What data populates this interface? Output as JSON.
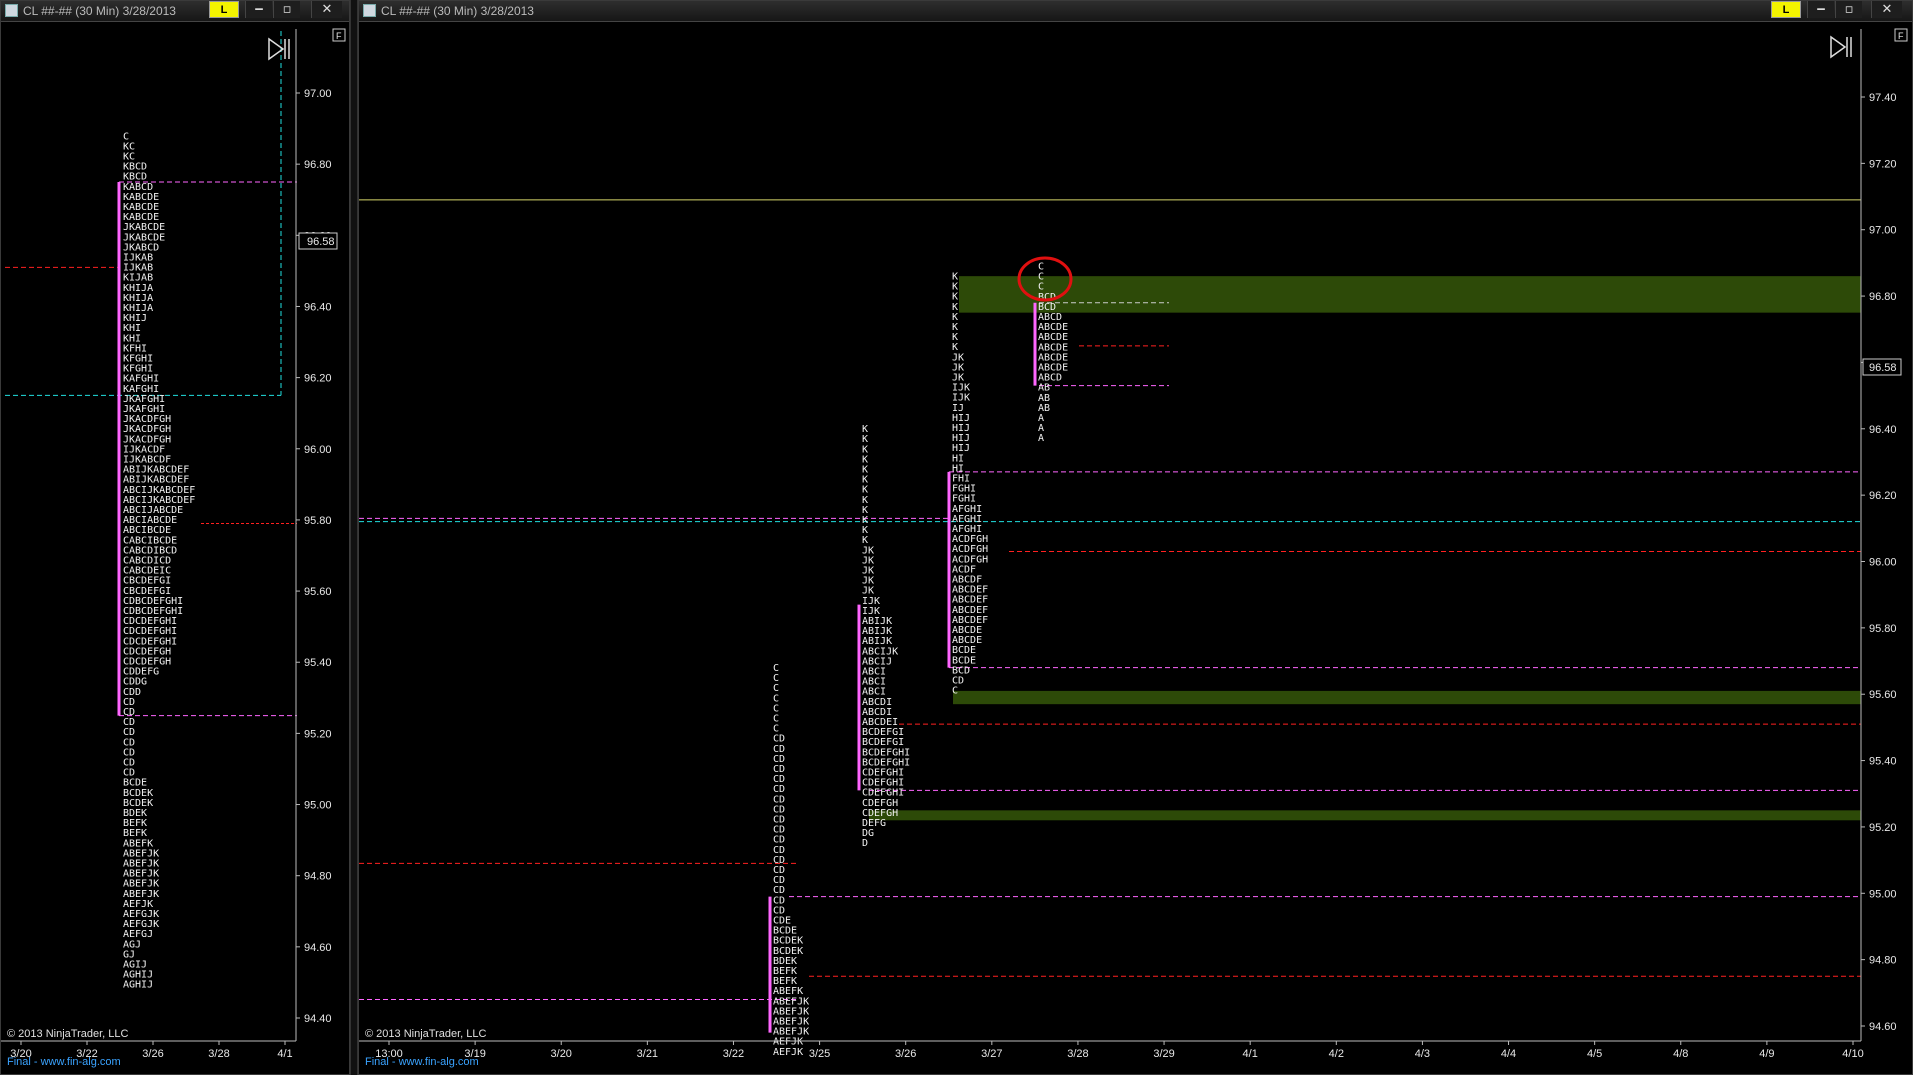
{
  "left_window": {
    "title": "CL ##-## (30 Min)  3/28/2013",
    "l_label": "L",
    "min_icon": "minimize-icon",
    "max_icon": "maximize-icon",
    "close_icon": "close-icon",
    "f_label": "F",
    "copyright": "© 2013 NinjaTrader, LLC",
    "final_label": "Final - www.fin-alg.com",
    "price_badge": "96.58",
    "y_ticks": [
      "97.00",
      "96.80",
      "96.60",
      "96.40",
      "96.20",
      "96.00",
      "95.80",
      "95.60",
      "95.40",
      "95.20",
      "95.00",
      "94.80",
      "94.60",
      "94.40"
    ],
    "x_ticks": [
      "3/20",
      "3/22",
      "3/26",
      "3/28",
      "4/1"
    ]
  },
  "right_window": {
    "title": "CL ##-## (30 Min)  3/28/2013",
    "l_label": "L",
    "min_icon": "minimize-icon",
    "max_icon": "maximize-icon",
    "close_icon": "close-icon",
    "f_label": "F",
    "copyright": "© 2013 NinjaTrader, LLC",
    "final_label": "Final - www.fin-alg.com",
    "price_badge": "96.58",
    "y_ticks": [
      "97.40",
      "97.20",
      "97.00",
      "96.80",
      "96.60",
      "96.40",
      "96.20",
      "96.00",
      "95.80",
      "95.60",
      "95.40",
      "95.20",
      "95.00",
      "94.80",
      "94.60"
    ],
    "x_ticks": [
      "13:00",
      "3/19",
      "3/20",
      "3/21",
      "3/22",
      "3/25",
      "3/26",
      "3/27",
      "3/28",
      "3/29",
      "4/1",
      "4/2",
      "4/3",
      "4/4",
      "4/5",
      "4/8",
      "4/9",
      "4/10"
    ]
  },
  "chart_data": [
    {
      "type": "market-profile",
      "panel": "left",
      "yscale": {
        "min": 94.4,
        "max": 97.0
      },
      "current_price": 96.58,
      "profile": {
        "top_price": 96.87,
        "rows": [
          "C",
          "KC",
          "KC",
          "KBCD",
          "KBCD",
          "KABCD",
          "KABCDE",
          "KABCDE",
          "KABCDE",
          "JKABCDE",
          "JKABCDE",
          "JKABCD",
          "IJKAB",
          "IJKAB",
          "KIJAB",
          "KHIJA",
          "KHIJA",
          "KHIJA",
          "KHIJ",
          "KHI",
          "KHI",
          "KFHI",
          "KFGHI",
          "KFGHI",
          "KAFGHI",
          "KAFGHI",
          "JKAFGHI",
          "JKAFGHI",
          "JKACDFGH",
          "JKACDFGH",
          "JKACDFGH",
          "IJKACDF",
          "IJKABCDF",
          "ABIJKABCDEF",
          "ABIJKABCDEF",
          "ABCIJKABCDEF",
          "ABCIJKABCDEF",
          "ABCIJABCDE",
          "ABCIABCDE",
          "ABCIBCDE",
          "CABCIBCDE",
          "CABCDIBCD",
          "CABCDICD",
          "CABCDEIC",
          "CBCDEFGI",
          "CBCDEFGI",
          "CDBCDEFGHI",
          "CDBCDEFGHI",
          "CDCDEFGHI",
          "CDCDEFGHI",
          "CDCDEFGHI",
          "CDCDEFGH",
          "CDCDEFGH",
          "CDDEFG",
          "CDDG",
          "CDD",
          "CD",
          "CD",
          "CD",
          "CD",
          "CD",
          "CD",
          "CD",
          "CD",
          "BCDE",
          "BCDEK",
          "BCDEK",
          "BDEK",
          "BEFK",
          "BEFK",
          "ABEFK",
          "ABEFJK",
          "ABEFJK",
          "ABEFJK",
          "ABEFJK",
          "ABEFJK",
          "AEFJK",
          "AEFGJK",
          "AEFGJK",
          "AEFGJ",
          "AGJ",
          "GJ",
          "AGIJ",
          "AGHIJ",
          "AGHIJ"
        ]
      },
      "value_area": {
        "high": 96.75,
        "low": 95.25
      },
      "poc": 95.79,
      "levels": [
        {
          "price": 96.51,
          "kind": "red-dashed"
        },
        {
          "price": 96.15,
          "kind": "cyan-dashed"
        },
        {
          "price": 97.18,
          "kind": "cyan-vertical-top"
        }
      ]
    },
    {
      "type": "market-profile",
      "panel": "right",
      "yscale": {
        "min": 94.6,
        "max": 97.4
      },
      "current_price": 96.58,
      "profiles": [
        {
          "date": "3/25",
          "top_price": 95.67,
          "rows": [
            "C",
            "C",
            "C",
            "C",
            "C",
            "C",
            "C",
            "CD",
            "CD",
            "CD",
            "CD",
            "CD",
            "CD",
            "CD",
            "CD",
            "CD",
            "CD",
            "CD",
            "CD",
            "CD",
            "CD",
            "CD",
            "CD",
            "CD",
            "CD",
            "CDE",
            "BCDE",
            "BCDEK",
            "BCDEK",
            "BDEK",
            "BEFK",
            "BEFK",
            "ABEFK",
            "ABEFJK",
            "ABEFJK",
            "ABEFJK",
            "ABEFJK",
            "AEFJK",
            "AEFJK"
          ]
        },
        {
          "date": "3/26",
          "top_price": 96.39,
          "rows": [
            "K",
            "K",
            "K",
            "K",
            "K",
            "K",
            "K",
            "K",
            "K",
            "K",
            "K",
            "K",
            "JK",
            "JK",
            "JK",
            "JK",
            "JK",
            "IJK",
            "IJK",
            "ABIJK",
            "ABIJK",
            "ABIJK",
            "ABCIJK",
            "ABCIJ",
            "ABCI",
            "ABCI",
            "ABCI",
            "ABCDI",
            "ABCDI",
            "ABCDEI",
            "BCDEFGI",
            "BCDEFGI",
            "BCDEFGHI",
            "BCDEFGHI",
            "CDEFGHI",
            "CDEFGHI",
            "CDEFGHI",
            "CDEFGH",
            "CDEFGH",
            "DEFG",
            "DG",
            "D"
          ]
        },
        {
          "date": "3/27",
          "top_price": 96.85,
          "rows": [
            "K",
            "K",
            "K",
            "K",
            "K",
            "K",
            "K",
            "K",
            "JK",
            "JK",
            "JK",
            "IJK",
            "IJK",
            "IJ",
            "HIJ",
            "HIJ",
            "HIJ",
            "HIJ",
            "HI",
            "HI",
            "FHI",
            "FGHI",
            "FGHI",
            "AFGHI",
            "AFGHI",
            "AFGHI",
            "ACDFGH",
            "ACDFGH",
            "ACDFGH",
            "ACDF",
            "ABCDF",
            "ABCDEF",
            "ABCDEF",
            "ABCDEF",
            "ABCDEF",
            "ABCDE",
            "ABCDE",
            "BCDE",
            "BCDE",
            "BCD",
            "CD",
            "C"
          ]
        },
        {
          "date": "3/28",
          "top_price": 96.88,
          "rows": [
            "C",
            "C",
            "C",
            "BCD",
            "BCD",
            "ABCD",
            "ABCDE",
            "ABCDE",
            "ABCDE",
            "ABCDE",
            "ABCDE",
            "ABCD",
            "AB",
            "AB",
            "AB",
            "A",
            "A",
            "A"
          ]
        }
      ],
      "single_print_zones": [
        {
          "from": 96.75,
          "to": 96.86
        },
        {
          "from": 95.57,
          "to": 95.61
        },
        {
          "from": 95.22,
          "to": 95.25
        }
      ],
      "levels": [
        {
          "price": 97.09,
          "kind": "yellow-solid"
        },
        {
          "price": 96.13,
          "kind": "magenta-dashed"
        },
        {
          "price": 96.27,
          "kind": "magenta-dashed"
        },
        {
          "price": 96.12,
          "kind": "cyan-dashed"
        },
        {
          "price": 96.03,
          "kind": "red-dashed"
        },
        {
          "price": 95.68,
          "kind": "magenta-dashed"
        },
        {
          "price": 95.51,
          "kind": "red-dashed"
        },
        {
          "price": 95.31,
          "kind": "magenta-dashed"
        },
        {
          "price": 95.09,
          "kind": "red-dashed"
        },
        {
          "price": 94.99,
          "kind": "magenta-dashed"
        },
        {
          "price": 94.75,
          "kind": "red-dashed"
        },
        {
          "price": 94.68,
          "kind": "magenta-dashed"
        },
        {
          "price": 96.78,
          "kind": "white-dashed"
        },
        {
          "price": 96.65,
          "kind": "red-dashed"
        },
        {
          "price": 96.53,
          "kind": "magenta-dashed"
        }
      ]
    }
  ],
  "colors": {
    "background": "#000000",
    "text": "#f2f2f2",
    "value_area": "#ff66ff",
    "poc": "#ff2020",
    "cyan": "#20e0e0",
    "single_print": "#2d4a08",
    "yellow_line": "#d7d76a",
    "highlight_circle": "#e01010",
    "final_blue": "#3aa3ff"
  }
}
